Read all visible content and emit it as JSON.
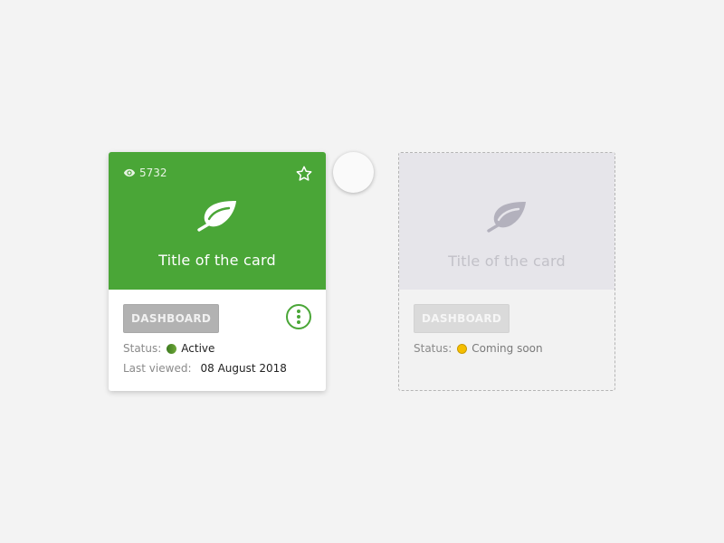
{
  "cards": [
    {
      "state": "active",
      "views": "5732",
      "title": "Title of the card",
      "button_label": "DASHBOARD",
      "status_label": "Status:",
      "status_value": "Active",
      "last_viewed_label": "Last viewed:",
      "last_viewed_value": "08 August 2018",
      "icons": {
        "views": "eye-icon",
        "favorite": "star-icon",
        "main": "leaf-icon",
        "menu": "more-vertical-icon"
      }
    },
    {
      "state": "placeholder",
      "title": "Title of the card",
      "button_label": "DASHBOARD",
      "status_label": "Status:",
      "status_value": "Coming soon",
      "icons": {
        "main": "leaf-icon"
      }
    }
  ],
  "colors": {
    "background": "#f3f3f3",
    "active_header": "#4aa637",
    "placeholder_header": "#e6e5ea",
    "status_active": "#4e8f2c",
    "status_coming_soon": "#f5be00"
  }
}
